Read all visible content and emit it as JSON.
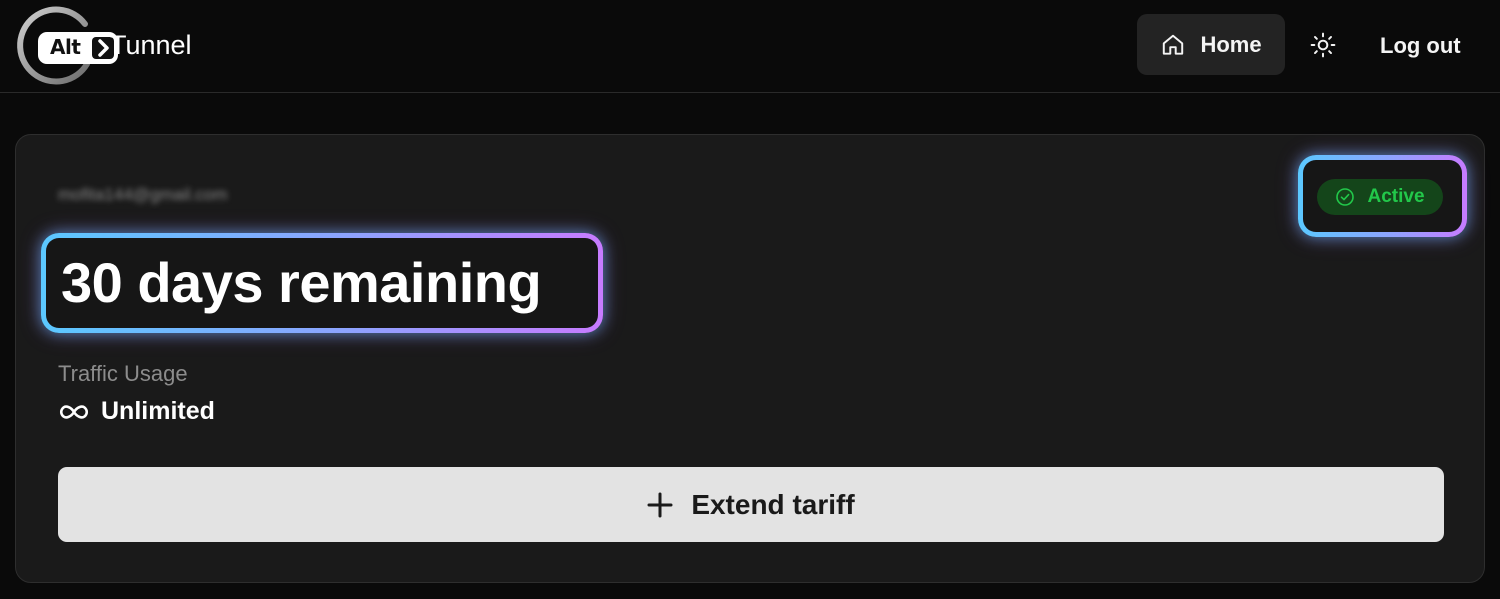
{
  "header": {
    "logo_badge": "Alt",
    "logo_text": "Tunnel",
    "nav": {
      "home_label": "Home",
      "home_icon": "home-icon",
      "theme_icon": "sun-icon",
      "logout_label": "Log out"
    }
  },
  "account": {
    "email": "mofita144@gmail.com",
    "status": "Active",
    "status_icon": "check-circle-icon",
    "days_remaining_text": "30 days remaining",
    "traffic_label": "Traffic Usage",
    "traffic_value": "Unlimited",
    "traffic_icon": "infinity-icon"
  },
  "actions": {
    "extend_label": "Extend tariff",
    "extend_icon": "plus-icon"
  },
  "colors": {
    "background": "#0a0a0a",
    "card": "#1a1a1a",
    "status_green": "#22c84a",
    "status_bg": "#14451a",
    "highlight_start": "#5bc8ff",
    "highlight_end": "#c77bff",
    "button_bg": "#e3e3e3"
  }
}
